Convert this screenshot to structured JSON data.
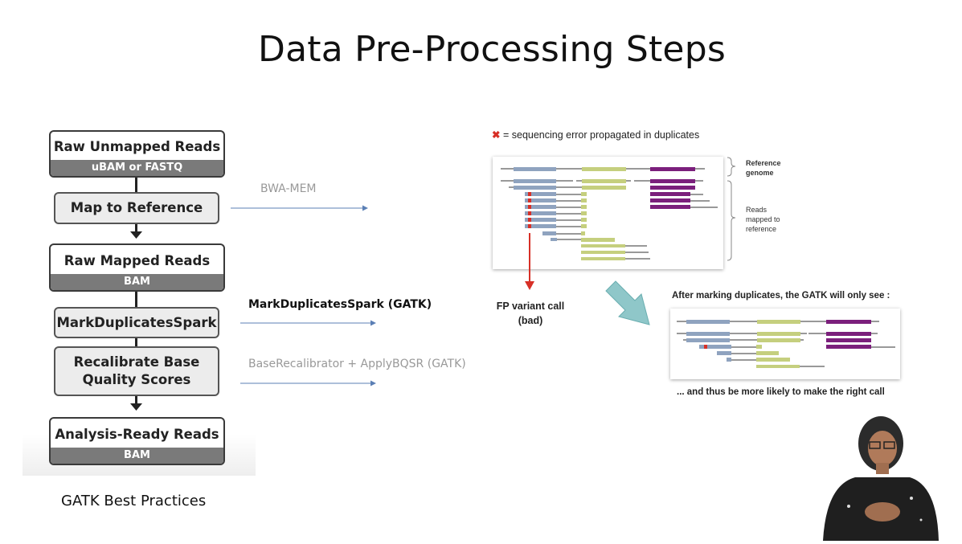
{
  "slide": {
    "title": "Data Pre-Processing Steps",
    "caption": "GATK Best Practices"
  },
  "pipeline": {
    "raw_unmapped": {
      "label": "Raw Unmapped Reads",
      "format": "uBAM or FASTQ"
    },
    "map_step": "Map to Reference",
    "raw_mapped": {
      "label": "Raw Mapped Reads",
      "format": "BAM"
    },
    "markdup_step": "MarkDuplicatesSpark",
    "recal_step_line1": "Recalibrate Base",
    "recal_step_line2": "Quality Scores",
    "analysis_ready": {
      "label": "Analysis-Ready Reads",
      "format": "BAM"
    }
  },
  "tools": {
    "bwa": "BWA-MEM",
    "markdup": "MarkDuplicatesSpark (GATK)",
    "bqsr": "BaseRecalibrator +  ApplyBQSR (GATK)"
  },
  "diagram": {
    "legend_symbol": "✖",
    "legend_text": "= sequencing error propagated in duplicates",
    "reference_label_line1": "Reference",
    "reference_label_line2": "genome",
    "reads_label_line1": "Reads",
    "reads_label_line2": "mapped to",
    "reads_label_line3": "reference",
    "fp_line1": "FP variant call",
    "fp_line2": "(bad)",
    "after_marking": "After marking duplicates, the GATK will only see :",
    "conclusion": "... and thus be more likely to make the right call"
  },
  "colors": {
    "segment_blue": "#8fa3bf",
    "segment_green": "#c5cf7e",
    "segment_purple": "#7b1f7c",
    "error_red": "#d73027",
    "arrow_teal": "#8fc7c9",
    "arrow_blue": "#5b7fb5",
    "box_footer_gray": "#7a7a7a"
  }
}
